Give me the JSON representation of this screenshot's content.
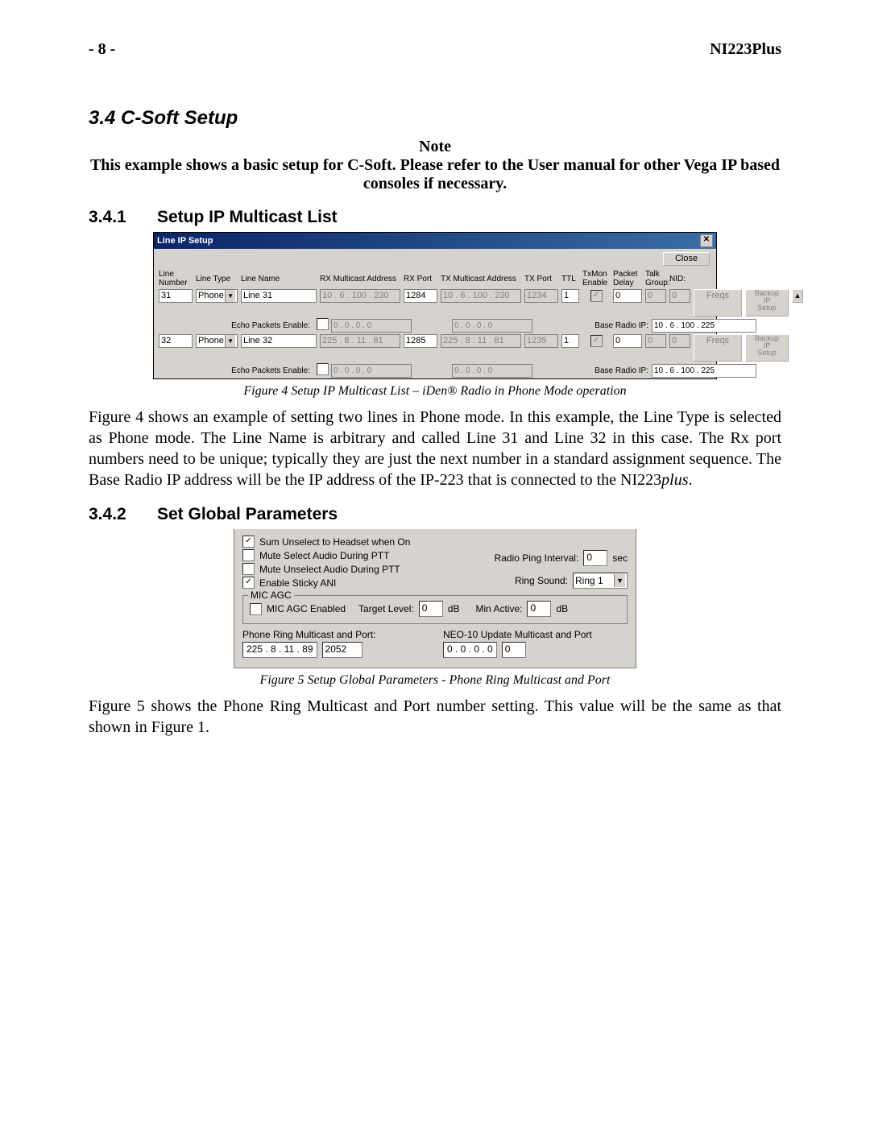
{
  "header": {
    "page_left": "- 8 -",
    "page_right": "NI223Plus"
  },
  "s34": {
    "title": "3.4    C-Soft Setup",
    "note_head": "Note",
    "note_body": "This example shows a basic setup for C-Soft. Please refer to the User manual for other Vega IP based consoles if necessary."
  },
  "s341": {
    "num": "3.4.1",
    "title": "Setup IP Multicast List",
    "window_title": "Line IP Setup",
    "close": "Close",
    "headers": {
      "line_number": "Line\nNumber",
      "line_type": "Line Type",
      "line_name": "Line Name",
      "rx_addr": "RX Multicast Address",
      "rx_port": "RX Port",
      "tx_addr": "TX Multicast Address",
      "tx_port": "TX Port",
      "ttl": "TTL",
      "txmon": "TxMon\nEnable",
      "packet_delay": "Packet\nDelay",
      "talk_group": "Talk\nGroup:",
      "nid": "NID:"
    },
    "echo_label": "Echo Packets Enable:",
    "base_radio_label": "Base Radio IP:",
    "freqs_btn": "Freqs",
    "backup_btn": "Backup\nIP\nSetup",
    "rows": [
      {
        "num": "31",
        "type": "Phone",
        "name": "Line 31",
        "rx_addr": "10 .  6 . 100 . 230",
        "rx_port": "1284",
        "tx_addr": "10 .  6 . 100 . 230",
        "tx_port": "1234",
        "ttl": "1",
        "txmon_checked": true,
        "packet_delay": "0",
        "talk_group": "0",
        "nid": "0",
        "echo_checked": false,
        "echo_rx": "0 .  0 .  0 .  0",
        "echo_tx": "0 .  0 .  0 .  0",
        "base_radio_ip": "10 .  6 . 100 . 225"
      },
      {
        "num": "32",
        "type": "Phone",
        "name": "Line 32",
        "rx_addr": "225 .  8 .  11 .  81",
        "rx_port": "1285",
        "tx_addr": "225 .  8 .  11 .  81",
        "tx_port": "1235",
        "ttl": "1",
        "txmon_checked": true,
        "packet_delay": "0",
        "talk_group": "0",
        "nid": "0",
        "echo_checked": false,
        "echo_rx": "0 .  0 .  0 .  0",
        "echo_tx": "0 .  0 .  0 .  0",
        "base_radio_ip": "10 .  6 . 100 . 225"
      }
    ],
    "caption": "Figure 4 Setup IP Multicast List – iDen® Radio in Phone Mode operation",
    "para": "Figure 4 shows an example of setting two lines in Phone mode. In this example, the Line Type is selected as Phone mode. The Line Name is arbitrary and called Line 31 and Line 32 in this case. The Rx port numbers need to be unique; typically they are just the next number in a standard assignment sequence. The Base Radio IP address will be the IP address of the IP-223 that is connected to the NI223"
  },
  "s342": {
    "num": "3.4.2",
    "title": "Set Global Parameters",
    "checks": {
      "sum_unselect": {
        "label": "Sum Unselect to Headset when On",
        "checked": true
      },
      "mute_select": {
        "label": "Mute Select Audio During PTT",
        "checked": false
      },
      "mute_unselect": {
        "label": "Mute Unselect Audio During PTT",
        "checked": false
      },
      "sticky_ani": {
        "label": "Enable Sticky ANI",
        "checked": true
      }
    },
    "radio_ping_label": "Radio Ping Interval:",
    "radio_ping_value": "0",
    "radio_ping_unit": "sec",
    "ring_sound_label": "Ring Sound:",
    "ring_sound_value": "Ring 1",
    "mic_agc": {
      "legend": "MIC AGC",
      "enabled_label": "MIC AGC Enabled",
      "enabled_checked": false,
      "target_label": "Target Level:",
      "target_value": "0",
      "target_unit": "dB",
      "min_active_label": "Min Active:",
      "min_active_value": "0",
      "min_active_unit": "dB"
    },
    "phone_ring": {
      "label": "Phone Ring Multicast and Port:",
      "ip": "225 .  8 .  11 .  89",
      "port": "2052"
    },
    "neo10": {
      "label": "NEO-10 Update Multicast and Port",
      "ip": "0 .  0 .  0 .  0",
      "port": "0"
    },
    "caption": "Figure 5 Setup Global Parameters - Phone Ring Multicast and Port",
    "para": "Figure 5 shows the Phone Ring Multicast and Port number setting. This value will be the same as that shown in Figure 1."
  }
}
